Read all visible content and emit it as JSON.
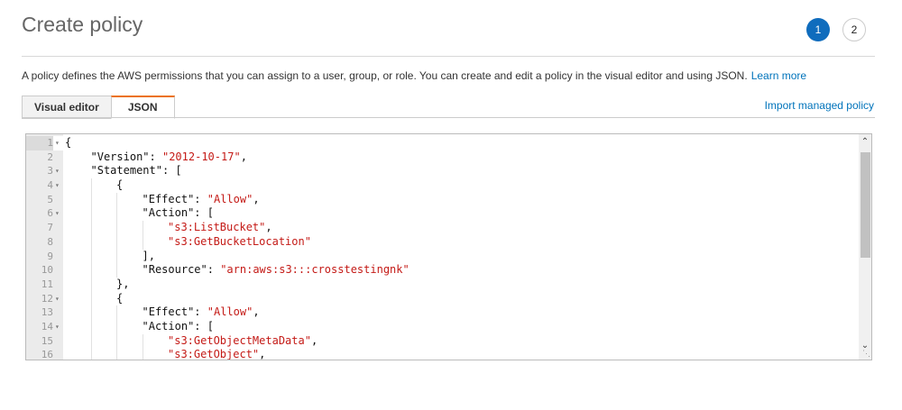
{
  "page": {
    "title": "Create policy",
    "steps": [
      "1",
      "2"
    ],
    "description": "A policy defines the AWS permissions that you can assign to a user, group, or role. You can create and edit a policy in the visual editor and using JSON.",
    "learn_more": "Learn more"
  },
  "tabs": [
    {
      "label": "Visual editor",
      "active": false
    },
    {
      "label": "JSON",
      "active": true
    }
  ],
  "import_label": "Import managed policy",
  "editor": {
    "lines": [
      {
        "n": "1",
        "fold": true,
        "indent": 0,
        "tokens": [
          {
            "t": "{"
          }
        ]
      },
      {
        "n": "2",
        "fold": false,
        "indent": 1,
        "tokens": [
          {
            "t": "\"Version\": "
          },
          {
            "t": "\"2012-10-17\"",
            "s": true
          },
          {
            "t": ","
          }
        ]
      },
      {
        "n": "3",
        "fold": true,
        "indent": 1,
        "tokens": [
          {
            "t": "\"Statement\": ["
          }
        ]
      },
      {
        "n": "4",
        "fold": true,
        "indent": 2,
        "tokens": [
          {
            "t": "{"
          }
        ]
      },
      {
        "n": "5",
        "fold": false,
        "indent": 3,
        "tokens": [
          {
            "t": "\"Effect\": "
          },
          {
            "t": "\"Allow\"",
            "s": true
          },
          {
            "t": ","
          }
        ]
      },
      {
        "n": "6",
        "fold": true,
        "indent": 3,
        "tokens": [
          {
            "t": "\"Action\": ["
          }
        ]
      },
      {
        "n": "7",
        "fold": false,
        "indent": 4,
        "tokens": [
          {
            "t": "\"s3:ListBucket\"",
            "s": true
          },
          {
            "t": ","
          }
        ]
      },
      {
        "n": "8",
        "fold": false,
        "indent": 4,
        "tokens": [
          {
            "t": "\"s3:GetBucketLocation\"",
            "s": true
          }
        ]
      },
      {
        "n": "9",
        "fold": false,
        "indent": 3,
        "tokens": [
          {
            "t": "],"
          }
        ]
      },
      {
        "n": "10",
        "fold": false,
        "indent": 3,
        "tokens": [
          {
            "t": "\"Resource\": "
          },
          {
            "t": "\"arn:aws:s3:::crosstestingnk\"",
            "s": true
          }
        ]
      },
      {
        "n": "11",
        "fold": false,
        "indent": 2,
        "tokens": [
          {
            "t": "},"
          }
        ]
      },
      {
        "n": "12",
        "fold": true,
        "indent": 2,
        "tokens": [
          {
            "t": "{"
          }
        ]
      },
      {
        "n": "13",
        "fold": false,
        "indent": 3,
        "tokens": [
          {
            "t": "\"Effect\": "
          },
          {
            "t": "\"Allow\"",
            "s": true
          },
          {
            "t": ","
          }
        ]
      },
      {
        "n": "14",
        "fold": true,
        "indent": 3,
        "tokens": [
          {
            "t": "\"Action\": ["
          }
        ]
      },
      {
        "n": "15",
        "fold": false,
        "indent": 4,
        "tokens": [
          {
            "t": "\"s3:GetObjectMetaData\"",
            "s": true
          },
          {
            "t": ","
          }
        ]
      },
      {
        "n": "16",
        "fold": false,
        "indent": 4,
        "tokens": [
          {
            "t": "\"s3:GetObject\"",
            "s": true
          },
          {
            "t": ","
          }
        ]
      }
    ]
  },
  "colors": {
    "accent": "#0f6cbd",
    "tab_highlight": "#ec7211",
    "link": "#0073bb",
    "string": "#c41a16"
  }
}
